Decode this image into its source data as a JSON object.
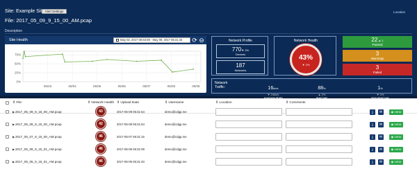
{
  "header": {
    "site_title": "Site: Example Site",
    "alert_settings_label": "Alert Settings",
    "file_title": "File: 2017_05_09_9_15_00_AM.pcap",
    "location_link": "Location",
    "description_label": "Description"
  },
  "site_health": {
    "title": "Site Health",
    "date_range": "May 02, 2017 06:53:08 - May 09, 2017 06:31:34",
    "calendar_icon": "calendar-icon",
    "refresh_icon": "refresh-icon",
    "zoom_icon": "zoom-out-icon"
  },
  "chart_data": {
    "type": "line",
    "title": "",
    "xlabel": "",
    "ylabel": "",
    "x_tick_labels": [
      "05/03",
      "05/04",
      "05/05",
      "05/06",
      "05/07",
      "05/08",
      "05/09"
    ],
    "y_tick_labels": [
      "0%",
      "25%",
      "50%",
      "75%"
    ],
    "ylim": [
      0,
      85
    ],
    "xlim": [
      0,
      7.2
    ],
    "grid": true,
    "series": [
      {
        "color": "#6fb04a",
        "points": [
          {
            "x": 0.0,
            "y": 65
          },
          {
            "x": 0.05,
            "y": 90
          },
          {
            "x": 0.1,
            "y": 70
          },
          {
            "x": 1.6,
            "y": 77
          },
          {
            "x": 1.7,
            "y": 55
          },
          {
            "x": 2.8,
            "y": 57
          },
          {
            "x": 3.4,
            "y": 62
          },
          {
            "x": 4.6,
            "y": 57
          },
          {
            "x": 5.6,
            "y": 60
          },
          {
            "x": 6.05,
            "y": 27
          },
          {
            "x": 6.9,
            "y": 35
          }
        ]
      }
    ]
  },
  "network_profile": {
    "title": "Network Profile",
    "devices_value": "770",
    "devices_change": "▼ 2%",
    "devices_label": "Devices",
    "networks_value": "187",
    "networks_label": "Networks"
  },
  "network_health": {
    "title": "Network Health",
    "value": "43%",
    "change": "▼ 2%"
  },
  "status": [
    {
      "value": "22",
      "sub": "▲ 1",
      "label": "Passed",
      "color": "#2e9a3e"
    },
    {
      "value": "3",
      "sub": "",
      "label": "Warnings",
      "color": "#d48f1c"
    },
    {
      "value": "3",
      "sub": "",
      "label": "Failed",
      "color": "#c62828"
    }
  ],
  "traffic": {
    "label_line1": "Network",
    "label_line2": "Traffic:",
    "avg_rate_value": "16",
    "avg_rate_unit": "kb/s",
    "avg_rate_sub": "▼ 24kb/s",
    "avg_rate_label": "Average Rate",
    "bacnet_value": "88",
    "bacnet_unit": "%",
    "bacnet_sub": "▲ 2%",
    "bacnet_label": "BACnet",
    "nonbacnet_value": "1",
    "nonbacnet_unit": "%",
    "nonbacnet_sub": "▼ 0%",
    "nonbacnet_label": "Non-BACnet"
  },
  "table": {
    "headers": {
      "file": "⇕ File",
      "health": "⇕ Network Health",
      "upload": "⇕ Upload Date",
      "username": "⇕ Username",
      "location": "⇕ Location",
      "comments": "⇕ Comments"
    },
    "view_label": "VIEW",
    "rows": [
      {
        "file": "2017_05_09_9_15_00_AM.pcap",
        "health": "43",
        "date": "2017-05-09 06:31:54",
        "user": "demo@cdgp.me"
      },
      {
        "file": "2017_05_08_9_15_00_AM.pcap",
        "health": "42",
        "date": "2017-05-08 06:31:54",
        "user": "demo@cdgp.me"
      },
      {
        "file": "2017_05_07_9_15_00_AM.pcap",
        "health": "46",
        "date": "2017-05-07 06:31:16",
        "user": "demo@cdgp.me"
      },
      {
        "file": "2017_05_06_9_15_01_AM.pcap",
        "health": "46",
        "date": "2017-05-06 06:31:09",
        "user": "demo@cdgp.me"
      },
      {
        "file": "2017_05_05_9_15_01_AM.pcap",
        "health": "46",
        "date": "2017-05-05 06:31:40",
        "user": "demo@cdgp.me"
      }
    ]
  }
}
